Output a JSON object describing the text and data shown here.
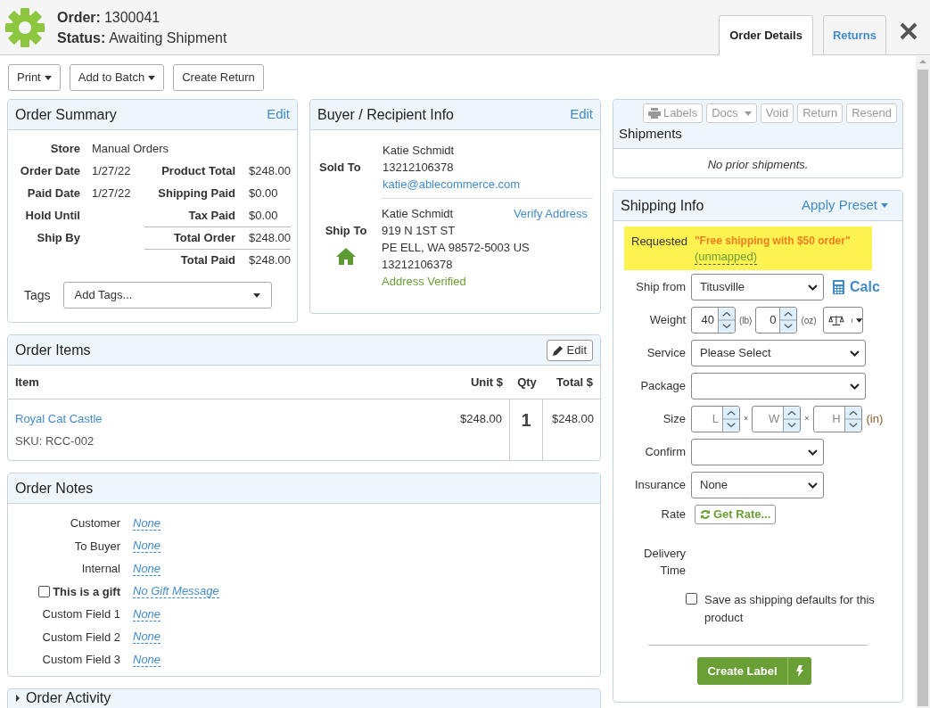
{
  "header": {
    "order_label": "Order:",
    "order_number": "1300041",
    "status_label": "Status:",
    "status": "Awaiting Shipment"
  },
  "tabs": [
    {
      "label": "Order Details",
      "selected": true
    },
    {
      "label": "Returns",
      "selected": false
    }
  ],
  "toolbar": [
    {
      "label": "Print",
      "dropdown": true
    },
    {
      "label": "Add to Batch",
      "dropdown": true
    },
    {
      "label": "Create Return",
      "dropdown": false
    }
  ],
  "order_summary": {
    "title": "Order Summary",
    "edit": "Edit",
    "store_label": "Store",
    "store": "Manual Orders",
    "rows": [
      {
        "label": "Order Date",
        "value": "1/27/22",
        "total_label": "Product Total",
        "total_value": "$248.00",
        "divider": false
      },
      {
        "label": "Paid Date",
        "value": "1/27/22",
        "total_label": "Shipping Paid",
        "total_value": "$0.00",
        "divider": false
      },
      {
        "label": "Hold Until",
        "total_label": "Tax Paid",
        "total_value": "$0.00",
        "divider": false
      },
      {
        "label": "Ship By",
        "total_label": "Total Order",
        "total_value": "$248.00",
        "divider": true
      },
      {
        "total_label": "Total Paid",
        "total_value": "$248.00",
        "divider": true
      }
    ],
    "tags_label": "Tags",
    "tags_placeholder": "Add Tags..."
  },
  "buyer": {
    "title": "Buyer / Recipient Info",
    "edit": "Edit",
    "sold_to": {
      "label": "Sold To",
      "name": "Katie Schmidt",
      "phone": "13212106378",
      "email": "katie@ablecommerce.com"
    },
    "ship_to": {
      "label": "Ship To",
      "name": "Katie Schmidt",
      "verify": "Verify Address",
      "lines": [
        "919 N 1ST ST",
        "PE ELL, WA 98572-5003 US",
        "13212106378"
      ],
      "status": "Address Verified"
    }
  },
  "order_items": {
    "title": "Order Items",
    "edit": "Edit",
    "columns": [
      "Item",
      "Unit $",
      "Qty",
      "Total $"
    ],
    "rows": [
      {
        "name": "Royal Cat Castle",
        "sku": "SKU: RCC-002",
        "unit": "$248.00",
        "qty": "1",
        "total": "$248.00"
      }
    ]
  },
  "order_notes": {
    "title": "Order Notes",
    "rows": [
      {
        "kind": "text",
        "label": "Customer",
        "value": "None"
      },
      {
        "kind": "text",
        "label": "To Buyer",
        "value": "None"
      },
      {
        "kind": "text",
        "label": "Internal",
        "value": "None"
      },
      {
        "kind": "checkbox",
        "label": "This is a gift",
        "checked": false,
        "value": "No Gift Message"
      },
      {
        "kind": "text",
        "label": "Custom Field 1",
        "value": "None"
      },
      {
        "kind": "text",
        "label": "Custom Field 2",
        "value": "None"
      },
      {
        "kind": "text",
        "label": "Custom Field 3",
        "value": "None"
      }
    ]
  },
  "order_activity": {
    "title": "Order Activity",
    "expanded": false
  },
  "shipments": {
    "title": "Shipments",
    "empty": "No prior shipments.",
    "buttons": [
      {
        "kind": "print",
        "label": "Labels",
        "dropdown": false,
        "disabled": true
      },
      {
        "kind": "plain",
        "label": "Docs",
        "dropdown": true,
        "disabled": true
      },
      {
        "kind": "plain",
        "label": "Void",
        "dropdown": false,
        "disabled": true
      },
      {
        "kind": "plain",
        "label": "Return",
        "dropdown": false,
        "disabled": true
      },
      {
        "kind": "plain",
        "label": "Resend",
        "dropdown": false,
        "disabled": true
      }
    ]
  },
  "shipping_info": {
    "title": "Shipping Info",
    "preset": "Apply Preset",
    "requested_label": "Requested",
    "requested_value": "\"Free shipping with $50 order\"",
    "mapping_note": "(unmapped)",
    "ship_from_label": "Ship from",
    "ship_from": "Titusville",
    "calc": "Calc",
    "weight_label": "Weight",
    "weight_lb": "40",
    "lb_unit": "(lb)",
    "weight_oz": "0",
    "oz_unit": "(oz)",
    "service_label": "Service",
    "service": "Please Select",
    "package_label": "Package",
    "size_label": "Size",
    "size_placeholders": [
      "L",
      "W",
      "H"
    ],
    "size_separator": "×",
    "size_unit": "(in)",
    "confirm_label": "Confirm",
    "insurance_label": "Insurance",
    "insurance": "None",
    "rate_label": "Rate",
    "get_rate": "Get Rate...",
    "delivery_label": "Delivery Time",
    "save_defaults": {
      "label": "Save as shipping defaults for this product",
      "checked": false
    },
    "create_label": "Create Label"
  }
}
